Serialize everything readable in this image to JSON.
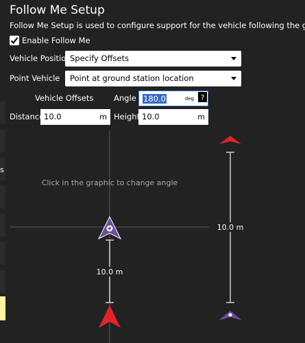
{
  "title": "Follow Me Setup",
  "description": "Follow Me Setup is used to configure support for the vehicle following the ground station lo",
  "enable": {
    "label": "Enable Follow Me",
    "checked": true
  },
  "vehicle_position": {
    "label": "Vehicle Position",
    "value": "Specify Offsets"
  },
  "point_vehicle": {
    "label": "Point Vehicle",
    "value": "Point at ground station location"
  },
  "offsets": {
    "heading": "Vehicle Offsets",
    "angle_label": "Angle",
    "angle_value": "180.0",
    "angle_unit": "deg",
    "help": "?",
    "distance_label": "Distance",
    "distance_value": "10.0",
    "distance_unit": "m",
    "height_label": "Height",
    "height_value": "10.0",
    "height_unit": "m"
  },
  "graphic": {
    "hint": "Click in the graphic to change angle",
    "distance_readout": "10.0 m",
    "height_readout": "10.0 m"
  },
  "sidebar_fragment": {
    "letter": "s"
  },
  "colors": {
    "background": "#222222",
    "vehicle_purple": "#6c4d9c",
    "gcs_red": "#e0242a",
    "selection_blue": "#3569c8"
  }
}
